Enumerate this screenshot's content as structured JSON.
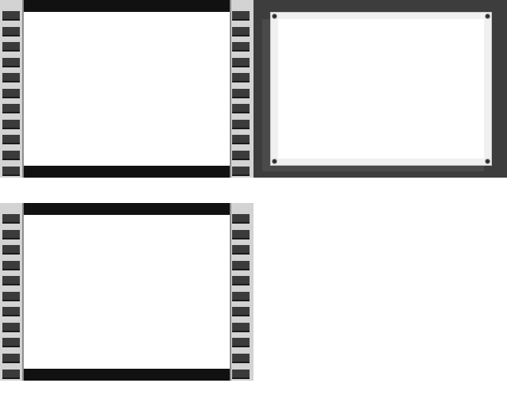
{
  "colors": {
    "film_background": "#d3d3d3",
    "film_hole": "#3b3b3b",
    "film_bar": "#111111",
    "screen": "#ffffff",
    "board_background": "#3d3d3d",
    "card": "#f0f0f0"
  },
  "icons": [
    "film-strip-icon",
    "pin-icon"
  ]
}
